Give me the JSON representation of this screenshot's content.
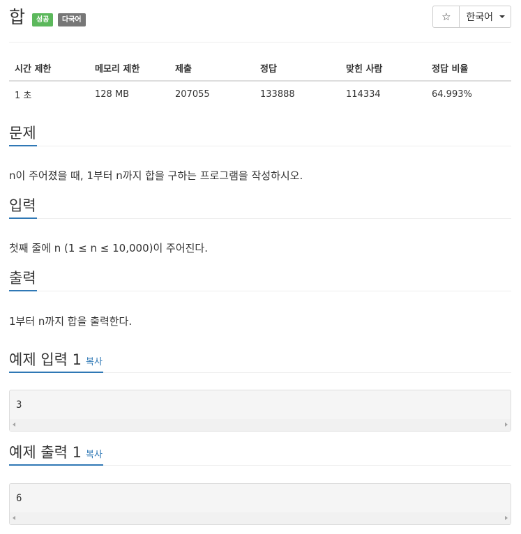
{
  "header": {
    "title": "합",
    "badges": [
      "성공",
      "다국어"
    ],
    "star_icon": "star-icon",
    "language_select": "한국어"
  },
  "limits": {
    "headers": [
      "시간 제한",
      "메모리 제한",
      "제출",
      "정답",
      "맞힌 사람",
      "정답 비율"
    ],
    "values": [
      "1 초",
      "128 MB",
      "207055",
      "133888",
      "114334",
      "64.993%"
    ]
  },
  "problem": {
    "heading": "문제",
    "text": "n이 주어졌을 때, 1부터 n까지 합을 구하는 프로그램을 작성하시오."
  },
  "input": {
    "heading": "입력",
    "text": "첫째 줄에 n (1 ≤ n ≤ 10,000)이 주어진다."
  },
  "output": {
    "heading": "출력",
    "text": "1부터 n까지 합을 출력한다."
  },
  "sample_input": {
    "heading": "예제 입력 1",
    "copy_label": "복사",
    "value": "3"
  },
  "sample_output": {
    "heading": "예제 출력 1",
    "copy_label": "복사",
    "value": "6"
  },
  "colors": {
    "success_badge": "#5cb85c",
    "language_badge": "#777777",
    "accent": "#2f78b5"
  }
}
